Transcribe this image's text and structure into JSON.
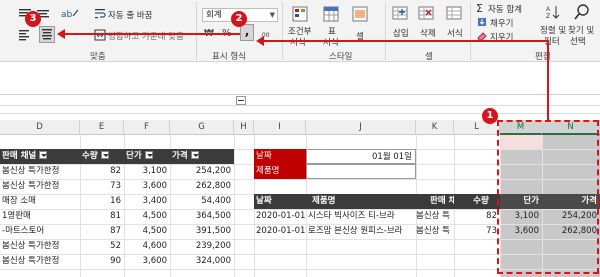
{
  "ribbon": {
    "wrap_text_label": "자동 줄 바꿈",
    "merge_label": "병합하고 가운데 맞춤",
    "alignment_group": "맞춤",
    "number_format_value": "회계",
    "number_group": "표시 형식",
    "conditional_label": "조건부",
    "conditional_sub": "서식",
    "table_format_label": "표",
    "table_format_sub": "서식",
    "cell_style_sub": "셀",
    "style_group": "스타일",
    "insert_label": "삽입",
    "delete_label": "삭제",
    "format_label": "서식",
    "cells_group": "셀",
    "autosum_label": "자동 합계",
    "fill_label": "채우기",
    "clear_label": "지우기",
    "sort_label": "정렬 및",
    "sort_sub": "필터",
    "find_label": "찾기 및",
    "find_sub": "선택",
    "editing_group": "편집",
    "currency_symbol": "₩",
    "percent_symbol": "%",
    "comma_symbol": ","
  },
  "columns": [
    "D",
    "E",
    "F",
    "G",
    "H",
    "I",
    "J",
    "K",
    "L",
    "M",
    "N"
  ],
  "left_table": {
    "headers": [
      "판매 채널",
      "수량",
      "단가",
      "가격"
    ],
    "rows": [
      [
        "봄신상 특가한정",
        "82",
        "3,100",
        "254,200"
      ],
      [
        "봄신상 특가한정",
        "73",
        "3,600",
        "262,800"
      ],
      [
        "매장 소매",
        "16",
        "3,400",
        "54,400"
      ],
      [
        "1영판매",
        "81",
        "4,500",
        "364,500"
      ],
      [
        "-마트스토어",
        "87",
        "4,500",
        "391,500"
      ],
      [
        "봄신상 특가한정",
        "52",
        "4,600",
        "239,200"
      ],
      [
        "봄신상 특가한정",
        "90",
        "3,600",
        "324,000"
      ]
    ]
  },
  "criteria": {
    "date_label": "날짜",
    "date_value": "01월 01일",
    "product_label": "제품명"
  },
  "right_table": {
    "headers": [
      "날짜",
      "제품명",
      "판매 채널",
      "수량",
      "단가",
      "가격"
    ],
    "rows": [
      [
        "2020-01-01",
        "시스타 빅사이즈 티-브라",
        "봄신상 특",
        "82",
        "3,100",
        "254,200"
      ],
      [
        "2020-01-01",
        "로즈맘 본신상 원피스-브라",
        "봄신상 특",
        "73",
        "3,600",
        "262,800"
      ]
    ]
  },
  "callouts": [
    "1",
    "2",
    "3"
  ],
  "colors": {
    "accent_red": "#d7141c",
    "header_dark": "#3b3b3b",
    "criteria_red": "#c00000",
    "selected_fill": "#c8c8c8",
    "pink_cell": "#f6dede",
    "excel_green": "#217346"
  }
}
